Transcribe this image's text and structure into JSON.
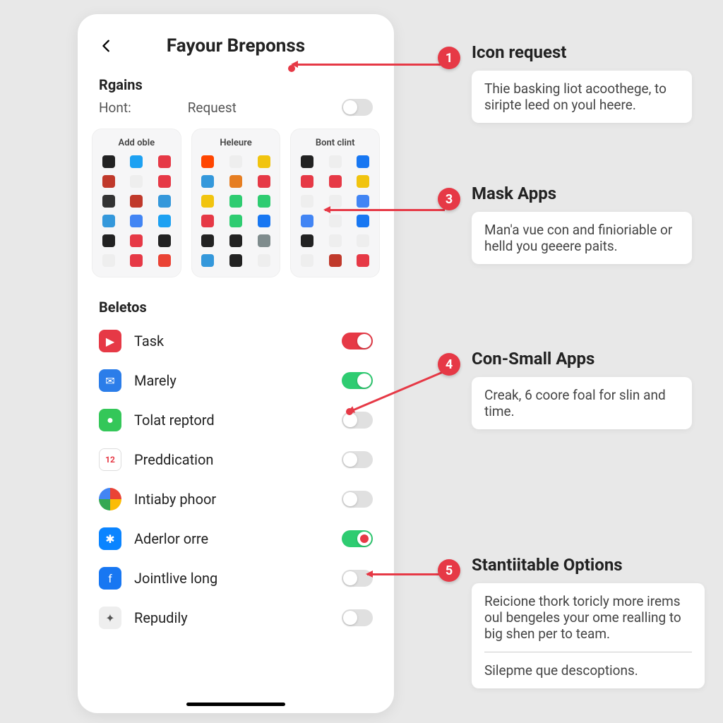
{
  "header": {
    "title": "Fayour Breponss"
  },
  "section1": {
    "label": "Rgains",
    "tab1": "Hont:",
    "tab2": "Request"
  },
  "gridCards": [
    {
      "title": "Add oble"
    },
    {
      "title": "Heleure"
    },
    {
      "title": "Bont clint"
    }
  ],
  "section2": {
    "label": "Beletos"
  },
  "apps": [
    {
      "label": "Task"
    },
    {
      "label": "Marely"
    },
    {
      "label": "Tolat reptord"
    },
    {
      "label": "Preddication"
    },
    {
      "label": "Intiaby phoor"
    },
    {
      "label": "Aderlor orre"
    },
    {
      "label": "Jointlive long"
    },
    {
      "label": "Repudily"
    }
  ],
  "annotations": {
    "a1": {
      "num": "1",
      "title": "Icon request",
      "body": "Thie basking liot acoothege, to siripte leed on youl heere."
    },
    "a3": {
      "num": "3",
      "title": "Mask Apps",
      "body": "Man'a vue con and finioriable or helld you geeere paits."
    },
    "a4": {
      "num": "4",
      "title": "Con-Small Apps",
      "body": "Creak, 6 coore foal for slin and time."
    },
    "a5": {
      "num": "5",
      "title": "Stantiitable Options",
      "body": "Reicione thork toricly more irems oul bengeles your ome realling to big shen per to team.",
      "footer": "Silepme que descoptions."
    }
  }
}
